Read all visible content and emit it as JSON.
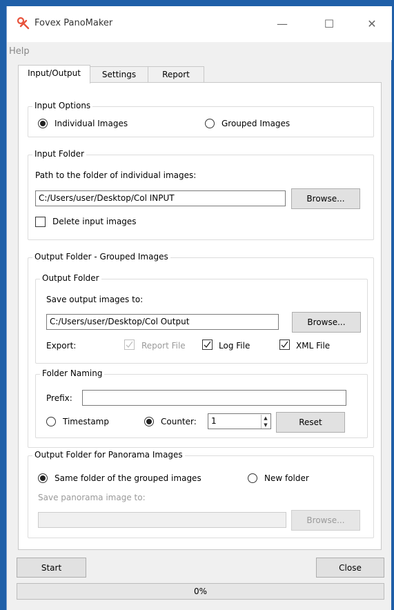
{
  "window": {
    "title": "Fovex PanoMaker",
    "minimize": "—",
    "maximize": "☐",
    "close": "✕"
  },
  "menu": {
    "help": "Help"
  },
  "tabs": [
    {
      "label": "Input/Output",
      "active": true
    },
    {
      "label": "Settings",
      "active": false
    },
    {
      "label": "Report",
      "active": false
    }
  ],
  "input_options": {
    "legend": "Input  Options",
    "individual": "Individual Images",
    "grouped": "Grouped Images",
    "selected": "individual"
  },
  "input_folder": {
    "legend": "Input Folder",
    "path_label": "Path to the folder of individual images:",
    "path_value": "C:/Users/user/Desktop/Col INPUT",
    "browse": "Browse...",
    "delete_label": "Delete input images",
    "delete_checked": false
  },
  "output_grouped": {
    "legend": "Output Folder - Grouped Images",
    "output_folder": {
      "legend": "Output Folder",
      "save_label": "Save output images to:",
      "save_value": "C:/Users/user/Desktop/Col Output",
      "browse": "Browse...",
      "export_label": "Export:",
      "report_file": "Report File",
      "log_file": "Log File",
      "xml_file": "XML File"
    },
    "folder_naming": {
      "legend": "Folder Naming",
      "prefix_label": "Prefix:",
      "prefix_value": "",
      "timestamp": "Timestamp",
      "counter": "Counter:",
      "counter_value": "1",
      "reset": "Reset",
      "selected": "counter"
    }
  },
  "panorama": {
    "legend": "Output Folder for Panorama Images",
    "same_folder": "Same folder of the grouped images",
    "new_folder": "New folder",
    "save_label": "Save panorama image to:",
    "save_value": "",
    "browse": "Browse...",
    "selected": "same"
  },
  "footer": {
    "start": "Start",
    "close": "Close",
    "progress_text": "0%",
    "progress_value": 0
  }
}
